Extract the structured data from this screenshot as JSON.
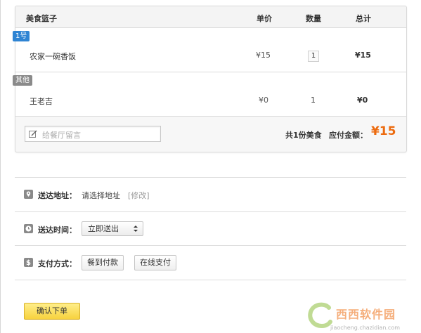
{
  "basket": {
    "columns": {
      "name": "美食篮子",
      "price": "单价",
      "qty": "数量",
      "total": "总计"
    },
    "groups": [
      {
        "tag": "1号",
        "item": {
          "name": "农家一碗香饭",
          "price": "¥15",
          "qty": "1",
          "total": "¥15"
        }
      },
      {
        "tag": "其他",
        "item": {
          "name": "王老吉",
          "price": "¥0",
          "qty": "1",
          "total": "¥0"
        }
      }
    ],
    "note_placeholder": "给餐厅留言",
    "summary_count": "共1份美食",
    "summary_label": "应付金额：",
    "summary_amount": "¥15"
  },
  "address": {
    "label": "送达地址：",
    "value": "请选择地址",
    "edit": "[修改]"
  },
  "delivery_time": {
    "label": "送达时间：",
    "selected": "立即送出"
  },
  "payment": {
    "label": "支付方式：",
    "options": [
      "餐到付款",
      "在线支付"
    ]
  },
  "confirm_label": "确认下单",
  "watermark": {
    "text": "西西软件园",
    "url": "jiaocheng.chazidian.com"
  },
  "colors": {
    "accent": "#ec6b0f",
    "tag_blue": "#2f84d3",
    "tag_gray": "#8a8a8a",
    "confirm_bg": "#f7d23e"
  }
}
